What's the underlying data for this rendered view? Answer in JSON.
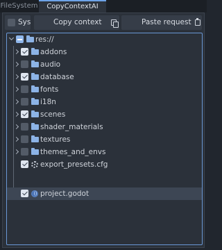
{
  "tabs": [
    {
      "label": "FileSystem"
    },
    {
      "label": "CopyContextAI"
    }
  ],
  "toolbar": {
    "sys_label": "Sys",
    "copy_label": "Copy context",
    "paste_label": "Paste request"
  },
  "tree": {
    "root": {
      "label": "res://",
      "state": "indeterminate"
    },
    "items": [
      {
        "label": "addons",
        "type": "folder",
        "checked": true
      },
      {
        "label": "audio",
        "type": "folder",
        "checked": false
      },
      {
        "label": "database",
        "type": "folder",
        "checked": true
      },
      {
        "label": "fonts",
        "type": "folder",
        "checked": false
      },
      {
        "label": "i18n",
        "type": "folder",
        "checked": false
      },
      {
        "label": "scenes",
        "type": "folder",
        "checked": true
      },
      {
        "label": "shader_materials",
        "type": "folder",
        "checked": false
      },
      {
        "label": "textures",
        "type": "folder",
        "checked": false
      },
      {
        "label": "themes_and_envs",
        "type": "folder",
        "checked": false
      },
      {
        "label": "export_presets.cfg",
        "type": "cfg-file",
        "checked": true
      },
      {
        "label": "project.godot",
        "type": "godot-file",
        "checked": true,
        "selected": true
      }
    ]
  },
  "colors": {
    "accent": "#6ea3e8",
    "folder": "#8cb3e6",
    "background": "#2b313a"
  }
}
